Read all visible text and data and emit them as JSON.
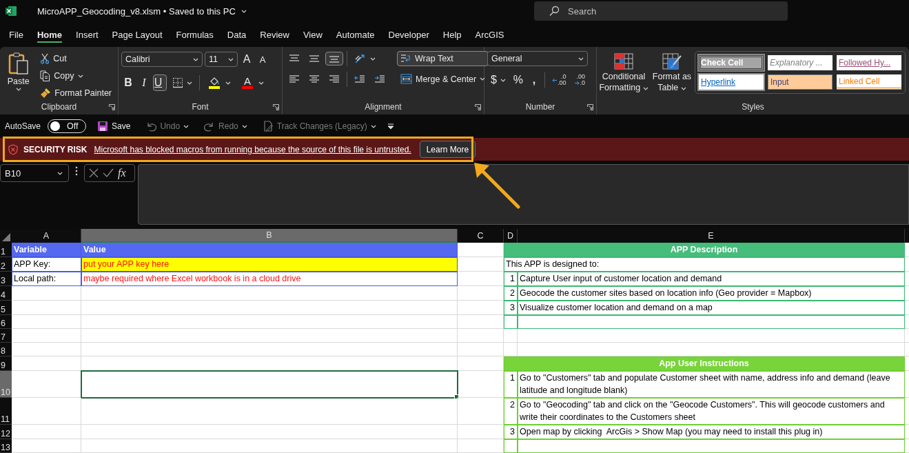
{
  "window": {
    "title": "MicroAPP_Geocoding_v8.xlsm • Saved to this PC"
  },
  "search": {
    "placeholder": "Search"
  },
  "menu_tabs": [
    {
      "label": "File",
      "selected": false
    },
    {
      "label": "Home",
      "selected": true
    },
    {
      "label": "Insert",
      "selected": false
    },
    {
      "label": "Page Layout",
      "selected": false
    },
    {
      "label": "Formulas",
      "selected": false
    },
    {
      "label": "Data",
      "selected": false
    },
    {
      "label": "Review",
      "selected": false
    },
    {
      "label": "View",
      "selected": false
    },
    {
      "label": "Automate",
      "selected": false
    },
    {
      "label": "Developer",
      "selected": false
    },
    {
      "label": "Help",
      "selected": false
    },
    {
      "label": "ArcGIS",
      "selected": false
    }
  ],
  "ribbon": {
    "clipboard": {
      "label": "Clipboard",
      "paste": "Paste",
      "cut": "Cut",
      "copy": "Copy",
      "format_painter": "Format Painter"
    },
    "font": {
      "label": "Font",
      "font_name": "Calibri",
      "font_size": "11",
      "grow": "A",
      "shrink": "A",
      "buttons": [
        {
          "kind": "bold",
          "glyph": "B",
          "selected": false
        },
        {
          "kind": "italic",
          "glyph": "I",
          "selected": false
        },
        {
          "kind": "underline",
          "glyph": "U",
          "selected": true
        },
        {
          "kind": "borders",
          "selected": false
        }
      ],
      "color_buttons": [
        {
          "kind": "fill",
          "color": "#ffff00"
        },
        {
          "kind": "font",
          "glyph": "A",
          "color": "#ff0000"
        }
      ]
    },
    "alignment": {
      "label": "Alignment",
      "buttons": [
        {
          "kind": "top",
          "selected": false
        },
        {
          "kind": "middle",
          "selected": false
        },
        {
          "kind": "bottom",
          "selected": true
        },
        {
          "kind": "orientation",
          "selected": false
        },
        {
          "kind": "left",
          "selected": false
        },
        {
          "kind": "center",
          "selected": false
        },
        {
          "kind": "right",
          "selected": false
        },
        {
          "kind": "outdent",
          "selected": false
        },
        {
          "kind": "indent",
          "selected": false
        }
      ],
      "wrap_text": {
        "label": "Wrap Text",
        "selected": true
      },
      "merge_center": "Merge & Center"
    },
    "number": {
      "label": "Number",
      "format": "General",
      "currency": "$",
      "percent": "%",
      "comma": ",",
      "increase_decimal": {
        "top": ".0",
        "bottom": ".00"
      },
      "decrease_decimal": {
        "top": ".00",
        "bottom": ".0"
      }
    },
    "styles": {
      "label": "Styles",
      "conditional_formatting": "Conditional Formatting",
      "format_as_table": "Format as Table",
      "gallery": [
        {
          "kind": "check",
          "label": "Check Cell"
        },
        {
          "kind": "explanatory",
          "label": "Explanatory ..."
        },
        {
          "kind": "followed",
          "label": "Followed Hy..."
        },
        {
          "kind": "hyperlink",
          "label": "Hyperlink"
        },
        {
          "kind": "input",
          "label": "Input"
        },
        {
          "kind": "linked",
          "label": "Linked Cell"
        }
      ]
    }
  },
  "quick_access": {
    "autosave_label": "AutoSave",
    "autosave": {
      "on": false,
      "label": "Off"
    },
    "items": [
      {
        "kind": "save",
        "label": "Save",
        "disabled": false
      },
      {
        "kind": "undo",
        "label": "Undo",
        "disabled": true
      },
      {
        "kind": "redo",
        "label": "Redo",
        "disabled": true
      },
      {
        "kind": "track",
        "label": "Track Changes (Legacy)",
        "disabled": true
      }
    ]
  },
  "security_bar": {
    "title": "SECURITY RISK",
    "message": "Microsoft has blocked macros from running because the source of this file is untrusted.",
    "button": "Learn More"
  },
  "formula_bar": {
    "name_box": "B10",
    "function_label": "fx"
  },
  "sheet": {
    "columns": [
      {
        "label": "A",
        "selected": false
      },
      {
        "label": "B",
        "selected": true
      },
      {
        "label": "C",
        "selected": false
      },
      {
        "label": "D",
        "selected": false
      },
      {
        "label": "E",
        "selected": false
      }
    ],
    "rows": [
      {
        "number": "1",
        "selected": false,
        "cells": {
          "a": {
            "kind": "var-header",
            "text": "Variable"
          },
          "b": {
            "kind": "var-header",
            "text": "Value"
          },
          "d": {
            "kind": "desc-header",
            "text": "APP Description"
          }
        }
      },
      {
        "number": "2",
        "selected": false,
        "cells": {
          "a": {
            "kind": "var-label",
            "text": "APP Key:"
          },
          "b": {
            "kind": "var-key",
            "text": "put your APP key here"
          },
          "d": {
            "kind": "desc-intro",
            "text": "This APP is designed to:"
          }
        }
      },
      {
        "number": "3",
        "selected": false,
        "cells": {
          "a": {
            "kind": "var-label",
            "text": "Local path:"
          },
          "b": {
            "kind": "var-note",
            "text": "maybe required where Excel workbook is in a cloud drive"
          },
          "d": {
            "kind": "desc-num",
            "text": "1"
          },
          "e": {
            "kind": "desc-item",
            "text": "Capture User input of customer location and demand"
          }
        }
      },
      {
        "number": "4",
        "selected": false,
        "cells": {
          "d": {
            "kind": "desc-num",
            "text": "2"
          },
          "e": {
            "kind": "desc-item",
            "text": "Geocode the customer sites based on location info (Geo provider = Mapbox)"
          }
        }
      },
      {
        "number": "5",
        "selected": false,
        "cells": {
          "d": {
            "kind": "desc-num",
            "text": "3"
          },
          "e": {
            "kind": "desc-item",
            "text": "Visualize customer location and demand on a map"
          }
        }
      },
      {
        "number": "6",
        "selected": false,
        "cells": {
          "d": {
            "kind": "desc-blank"
          },
          "e": {
            "kind": "desc-blank"
          }
        }
      },
      {
        "number": "7",
        "selected": false,
        "cells": {}
      },
      {
        "number": "8",
        "selected": false,
        "cells": {}
      },
      {
        "number": "9",
        "selected": false,
        "cells": {
          "d": {
            "kind": "instr-header",
            "text": "App User Instructions"
          }
        }
      },
      {
        "number": "10",
        "selected": true,
        "cells": {
          "d": {
            "kind": "instr-num",
            "text": "1"
          },
          "e": {
            "kind": "instr-item",
            "text": "Go to \"Customers\" tab and populate Customer sheet with name, address info and demand (leave latitude and longitude blank)"
          }
        }
      },
      {
        "number": "11",
        "selected": false,
        "cells": {
          "d": {
            "kind": "instr-num",
            "text": "2"
          },
          "e": {
            "kind": "instr-item",
            "text": "Go to \"Geocoding\" tab and click on the \"Geocode Customers\". This will geocode customers and write their coordinates to the Customers sheet"
          }
        }
      },
      {
        "number": "12",
        "selected": false,
        "cells": {
          "d": {
            "kind": "instr-num",
            "text": "3"
          },
          "e": {
            "kind": "instr-item",
            "text": "Open map by clicking  ArcGis > Show Map (you may need to install this plug in)"
          }
        }
      },
      {
        "number": "13",
        "selected": false,
        "cells": {
          "d": {
            "kind": "instr-blank"
          },
          "e": {
            "kind": "instr-blank"
          }
        }
      }
    ]
  }
}
